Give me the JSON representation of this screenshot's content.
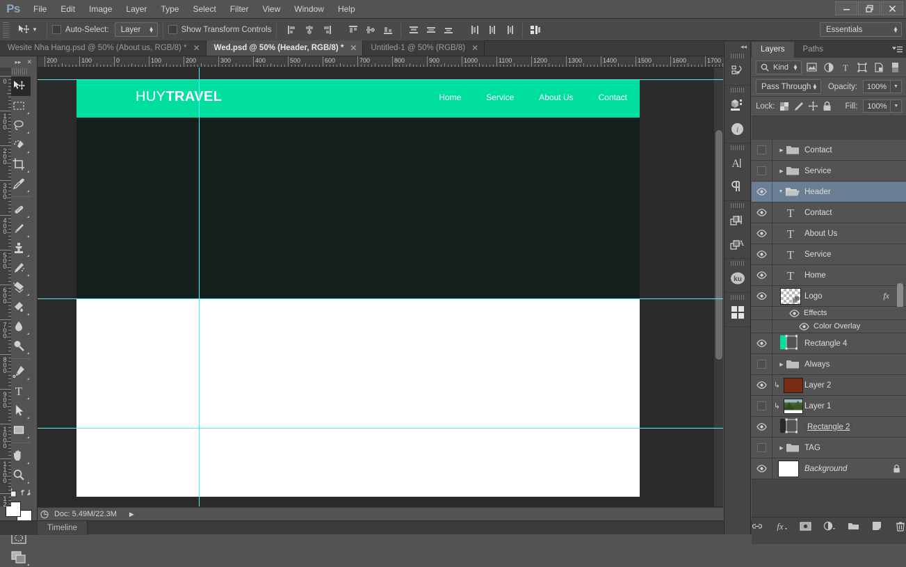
{
  "app": {
    "name": "Ps",
    "workspace": "Essentials"
  },
  "menubar": {
    "items": [
      "File",
      "Edit",
      "Image",
      "Layer",
      "Type",
      "Select",
      "Filter",
      "View",
      "Window",
      "Help"
    ]
  },
  "window_controls": {
    "minimize": "—",
    "restore": "❐",
    "close": "✕"
  },
  "options_bar": {
    "auto_select_label": "Auto-Select:",
    "auto_select_value": "Layer",
    "show_transform_label": "Show Transform Controls",
    "align_icons": [
      "align-left-edges-icon",
      "align-horizontal-centers-icon",
      "align-right-edges-icon",
      "align-top-edges-icon",
      "align-vertical-centers-icon",
      "align-bottom-edges-icon",
      "distribute-top-edges-icon",
      "distribute-vertical-centers-icon",
      "distribute-bottom-edges-icon",
      "distribute-left-edges-icon",
      "distribute-horizontal-centers-icon",
      "distribute-right-edges-icon",
      "auto-align-layers-icon"
    ]
  },
  "document_tabs": [
    {
      "label": "Wesite Nha Hang.psd @ 50% (About us, RGB/8) *",
      "active": false
    },
    {
      "label": "Wed.psd @ 50% (Header, RGB/8) *",
      "active": true
    },
    {
      "label": "Untitled-1 @ 50% (RGB/8)",
      "active": false
    }
  ],
  "toolbox": {
    "tools": [
      {
        "name": "move-tool",
        "active": true
      },
      {
        "name": "rectangular-marquee-tool",
        "active": false
      },
      {
        "name": "lasso-tool",
        "active": false
      },
      {
        "name": "quick-selection-tool",
        "active": false
      },
      {
        "name": "crop-tool",
        "active": false
      },
      {
        "name": "eyedropper-tool",
        "active": false
      },
      {
        "name": "spot-healing-brush-tool",
        "active": false
      },
      {
        "name": "brush-tool",
        "active": false
      },
      {
        "name": "clone-stamp-tool",
        "active": false
      },
      {
        "name": "history-brush-tool",
        "active": false
      },
      {
        "name": "eraser-tool",
        "active": false
      },
      {
        "name": "gradient-tool",
        "active": false
      },
      {
        "name": "blur-tool",
        "active": false
      },
      {
        "name": "dodge-tool",
        "active": false
      },
      {
        "name": "pen-tool",
        "active": false
      },
      {
        "name": "horizontal-type-tool",
        "active": false
      },
      {
        "name": "path-selection-tool",
        "active": false
      },
      {
        "name": "rectangle-tool",
        "active": false
      },
      {
        "name": "hand-tool",
        "active": false
      },
      {
        "name": "zoom-tool",
        "active": false
      }
    ],
    "foreground_color": "#ffffff",
    "background_color": "#ffffff"
  },
  "rulers": {
    "horizontal": [
      "200",
      "100",
      "0",
      "100",
      "200",
      "300",
      "400",
      "500",
      "600",
      "700",
      "800",
      "900",
      "1000",
      "1100",
      "1200",
      "1300",
      "1400",
      "1500",
      "1600",
      "1700"
    ],
    "vertical": [
      "0",
      "100",
      "200",
      "300",
      "400",
      "500",
      "600",
      "700",
      "800",
      "900",
      "1000",
      "1100",
      "12"
    ],
    "unit_spacing_px": 100
  },
  "canvas": {
    "header_logo_light": "HUY",
    "header_logo_bold": "TRAVEL",
    "nav_items": [
      "Home",
      "Service",
      "About Us",
      "Contact"
    ],
    "band_green": "#00dea0",
    "band_dark": "#15201e",
    "band_white": "#ffffff",
    "guide_color": "#4df3f0"
  },
  "status_bar": {
    "doc_info": "Doc: 5.49M/22.3M"
  },
  "bottom_bar": {
    "tabs": [
      "Timeline"
    ]
  },
  "icon_dock": {
    "items": [
      {
        "name": "history-panel-icon"
      },
      {
        "name": "3d-panel-icon"
      },
      {
        "name": "info-panel-icon"
      },
      {
        "name": "character-panel-icon"
      },
      {
        "name": "paragraph-panel-icon"
      },
      {
        "name": "character-styles-panel-icon"
      },
      {
        "name": "paragraph-styles-panel-icon"
      },
      {
        "name": "kuler-panel-icon",
        "label": "ku"
      },
      {
        "name": "mini-bridge-panel-icon"
      }
    ]
  },
  "layers_panel": {
    "tabs": [
      {
        "label": "Layers",
        "active": true
      },
      {
        "label": "Paths",
        "active": false
      }
    ],
    "filter_label": "Kind",
    "filter_icons": [
      "pixel-filter-icon",
      "adjustment-filter-icon",
      "type-filter-icon",
      "shape-filter-icon",
      "smart-object-filter-icon",
      "filter-toggle-icon"
    ],
    "blend_mode": "Pass Through",
    "opacity_label": "Opacity:",
    "opacity_value": "100%",
    "lock_label": "Lock:",
    "fill_label": "Fill:",
    "fill_value": "100%",
    "lock_icons": [
      "lock-transparent-pixels-icon",
      "lock-image-pixels-icon",
      "lock-position-icon",
      "lock-all-icon"
    ],
    "layers": [
      {
        "name": "Contact",
        "type": "group",
        "visible": false,
        "expanded": false,
        "selected": false,
        "indent": 0
      },
      {
        "name": "Service",
        "type": "group",
        "visible": false,
        "expanded": false,
        "selected": false,
        "indent": 0
      },
      {
        "name": "Header",
        "type": "group",
        "visible": true,
        "expanded": true,
        "selected": true,
        "indent": 0
      },
      {
        "name": "Contact",
        "type": "text",
        "visible": true,
        "selected": false,
        "indent": 1
      },
      {
        "name": "About Us",
        "type": "text",
        "visible": true,
        "selected": false,
        "indent": 1
      },
      {
        "name": "Service",
        "type": "text",
        "visible": true,
        "selected": false,
        "indent": 1
      },
      {
        "name": "Home",
        "type": "text",
        "visible": true,
        "selected": false,
        "indent": 1
      },
      {
        "name": "Logo",
        "type": "pixel-transparent",
        "visible": true,
        "selected": false,
        "indent": 1,
        "has_fx": true
      },
      {
        "name": "Effects",
        "type": "effects-row",
        "visible": true,
        "indent": 2
      },
      {
        "name": "Color Overlay",
        "type": "effect-item",
        "visible": true,
        "indent": 3
      },
      {
        "name": "Rectangle 4",
        "type": "shape",
        "visible": true,
        "selected": false,
        "indent": 0,
        "shape_color": "#00dea0"
      },
      {
        "name": "Always",
        "type": "group",
        "visible": false,
        "expanded": false,
        "selected": false,
        "indent": 0
      },
      {
        "name": "Layer 2",
        "type": "pixel",
        "visible": true,
        "selected": false,
        "indent": 0,
        "clipped": true,
        "thumb_color": "#7a2d12"
      },
      {
        "name": "Layer 1",
        "type": "photo",
        "visible": false,
        "selected": false,
        "indent": 0,
        "clipped": true
      },
      {
        "name": "Rectangle 2 ",
        "type": "shape",
        "visible": true,
        "selected": false,
        "indent": 0,
        "renaming": true,
        "shape_color": "#2a2a2a"
      },
      {
        "name": "TAG",
        "type": "group",
        "visible": false,
        "expanded": false,
        "selected": false,
        "indent": 0
      },
      {
        "name": "Background",
        "type": "background",
        "visible": true,
        "selected": false,
        "indent": 0,
        "locked": true,
        "italic": true,
        "thumb_color": "#ffffff"
      }
    ],
    "footer_icons": [
      "link-layers-icon",
      "add-layer-style-icon",
      "add-layer-mask-icon",
      "new-adjustment-layer-icon",
      "new-group-icon",
      "new-layer-icon",
      "delete-layer-icon"
    ]
  }
}
